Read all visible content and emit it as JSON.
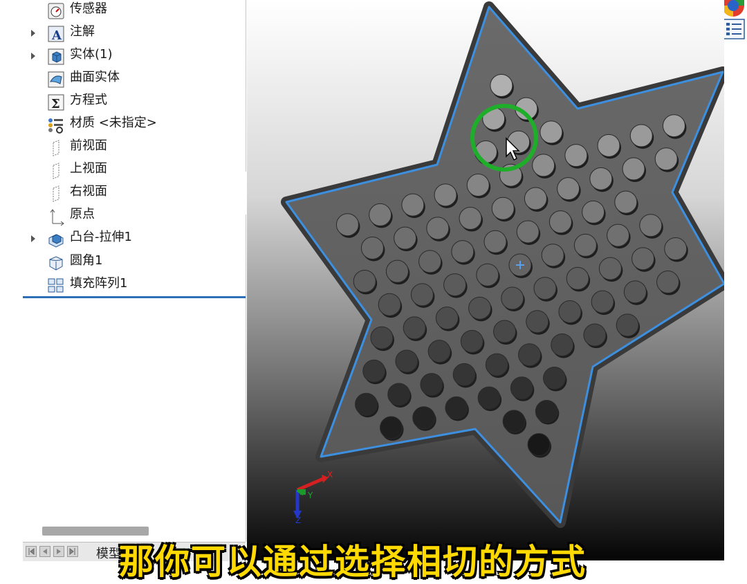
{
  "feature_tree": {
    "items": [
      {
        "label": "传感器",
        "icon": "sensor-icon",
        "expandable": false
      },
      {
        "label": "注解",
        "icon": "annotation-icon",
        "expandable": true
      },
      {
        "label": "实体(1)",
        "icon": "solid-body-icon",
        "expandable": true
      },
      {
        "label": "曲面实体",
        "icon": "surface-body-icon",
        "expandable": false
      },
      {
        "label": "方程式",
        "icon": "equation-icon",
        "expandable": false
      },
      {
        "label": "材质 <未指定>",
        "icon": "material-icon",
        "expandable": false
      },
      {
        "label": "前视面",
        "icon": "plane-icon",
        "expandable": false
      },
      {
        "label": "上视面",
        "icon": "plane-icon",
        "expandable": false
      },
      {
        "label": "右视面",
        "icon": "plane-icon",
        "expandable": false
      },
      {
        "label": "原点",
        "icon": "origin-icon",
        "expandable": false
      },
      {
        "label": "凸台-拉伸1",
        "icon": "boss-extrude-icon",
        "expandable": true
      },
      {
        "label": "圆角1",
        "icon": "fillet-icon",
        "expandable": false
      },
      {
        "label": "填充阵列1",
        "icon": "fill-pattern-icon",
        "expandable": false
      }
    ]
  },
  "bottom_tabs": {
    "model_tab_label": "模型"
  },
  "viewport": {
    "triad": {
      "x_label": "X",
      "y_label": "Y",
      "z_label": "Z"
    },
    "colors": {
      "part_face": "#5f5f5f",
      "edge_highlight": "#3d8fe0",
      "cursor_ring": "#1fae2a",
      "hole_dark": "#0c0c0c"
    }
  },
  "subtitle": {
    "text": "那你可以通过选择相切的方式"
  },
  "colors": {
    "tree_divider": "#2d6fb7",
    "subtitle_fill": "#ffd900"
  }
}
